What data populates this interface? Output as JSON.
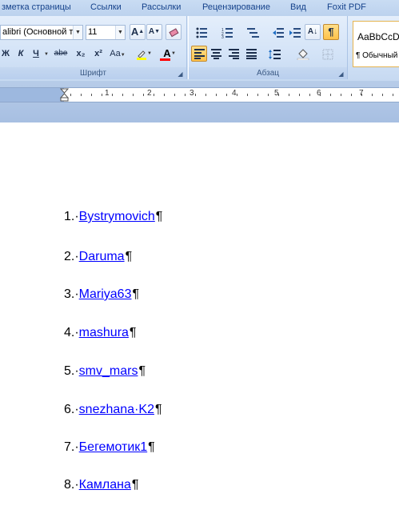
{
  "ribbon_tabs": [
    "зметка страницы",
    "Ссылки",
    "Рассылки",
    "Рецензирование",
    "Вид",
    "Foxit PDF"
  ],
  "font_group": {
    "font_name": "alibri (Основной те",
    "font_size": "11",
    "label": "Шрифт",
    "grow_glyph": "A",
    "shrink_glyph": "A",
    "bold": "Ж",
    "italic": "К",
    "underline": "Ч",
    "strike": "abe",
    "subscript": "x₂",
    "superscript": "x²",
    "case": "Aa",
    "font_color_glyph": "A"
  },
  "paragraph_group": {
    "label": "Абзац",
    "show_marks_glyph": "¶",
    "sort_glyph": "A↓"
  },
  "styles_group": {
    "sample": "AaBbCcD",
    "name": "¶ Обычный"
  },
  "ruler_numbers": [
    "1",
    "2",
    "3",
    "4",
    "5",
    "6",
    "7"
  ],
  "document_list": [
    {
      "number": "1.",
      "text": "Bystrymovich"
    },
    {
      "number": "2.",
      "text": "Daruma"
    },
    {
      "number": "3.",
      "text": "Mariya63"
    },
    {
      "number": "4.",
      "text": "mashura"
    },
    {
      "number": "5.",
      "text": "smv_mars"
    },
    {
      "number": "6.",
      "text": "snezhana·K2"
    },
    {
      "number": "7.",
      "text": "Бегемотик1"
    },
    {
      "number": "8.",
      "text": "Камлана"
    }
  ],
  "pilcrow": "¶",
  "accent_colors": {
    "tab_text": "#15428b",
    "hyperlink": "#0000ff",
    "active_button": "#ffc24a"
  }
}
